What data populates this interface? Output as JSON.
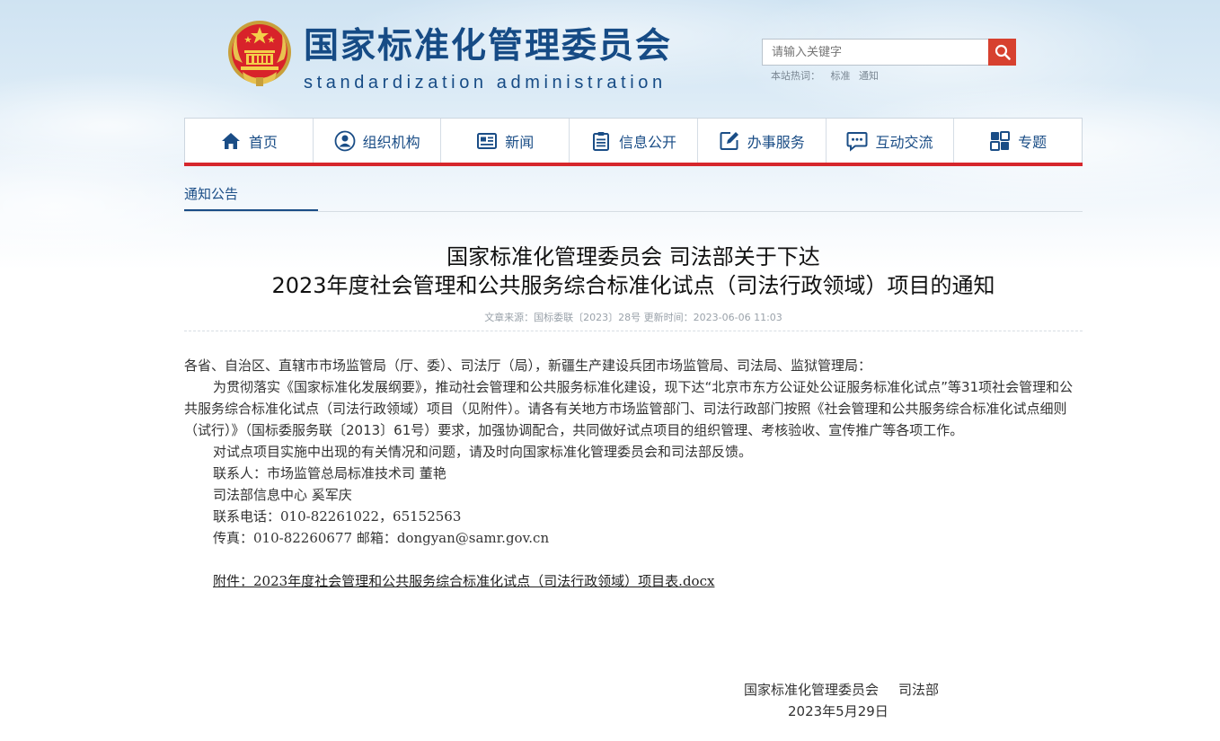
{
  "header": {
    "title_cn": "国家标准化管理委员会",
    "title_en": "standardization administration",
    "emblem_icon": "national-emblem-icon"
  },
  "search": {
    "placeholder": "请输入关键字",
    "hot_label": "本站热词：",
    "hot_words": [
      "标准",
      "通知"
    ]
  },
  "nav": {
    "items": [
      {
        "label": "首页",
        "icon": "home-icon"
      },
      {
        "label": "组织机构",
        "icon": "user-icon"
      },
      {
        "label": "新闻",
        "icon": "news-icon"
      },
      {
        "label": "信息公开",
        "icon": "clipboard-icon"
      },
      {
        "label": "办事服务",
        "icon": "edit-icon"
      },
      {
        "label": "互动交流",
        "icon": "chat-icon"
      },
      {
        "label": "专题",
        "icon": "topics-icon"
      }
    ]
  },
  "section": {
    "label": "通知公告"
  },
  "article": {
    "title_line1": "国家标准化管理委员会 司法部关于下达",
    "title_line2": "2023年度社会管理和公共服务综合标准化试点（司法行政领域）项目的通知",
    "meta": "文章来源：国标委联〔2023〕28号 更新时间：2023-06-06 11:03",
    "salutation": "各省、自治区、直辖市市场监管局（厅、委）、司法厅（局），新疆生产建设兵团市场监管局、司法局、监狱管理局：",
    "para1": "为贯彻落实《国家标准化发展纲要》，推动社会管理和公共服务标准化建设，现下达“北京市东方公证处公证服务标准化试点”等31项社会管理和公共服务综合标准化试点（司法行政领域）项目（见附件）。请各有关地方市场监管部门、司法行政部门按照《社会管理和公共服务综合标准化试点细则（试行）》（国标委服务联〔2013〕61号）要求，加强协调配合，共同做好试点项目的组织管理、考核验收、宣传推广等各项工作。",
    "para2": "对试点项目实施中出现的有关情况和问题，请及时向国家标准化管理委员会和司法部反馈。",
    "contact1": "联系人：市场监管总局标准技术司 董艳",
    "contact2": "司法部信息中心 奚军庆",
    "phone": "联系电话：010-82261022，65152563",
    "fax": "传真：010-82260677 邮箱：dongyan@samr.gov.cn",
    "attachment": "附件：2023年度社会管理和公共服务综合标准化试点（司法行政领域）项目表.docx",
    "sign_org1": "国家标准化管理委员会",
    "sign_org2": "司法部",
    "sign_date": "2023年5月29日"
  },
  "colors": {
    "brand_blue": "#164b85",
    "nav_red": "#d6262c",
    "search_red": "#d7412f"
  }
}
